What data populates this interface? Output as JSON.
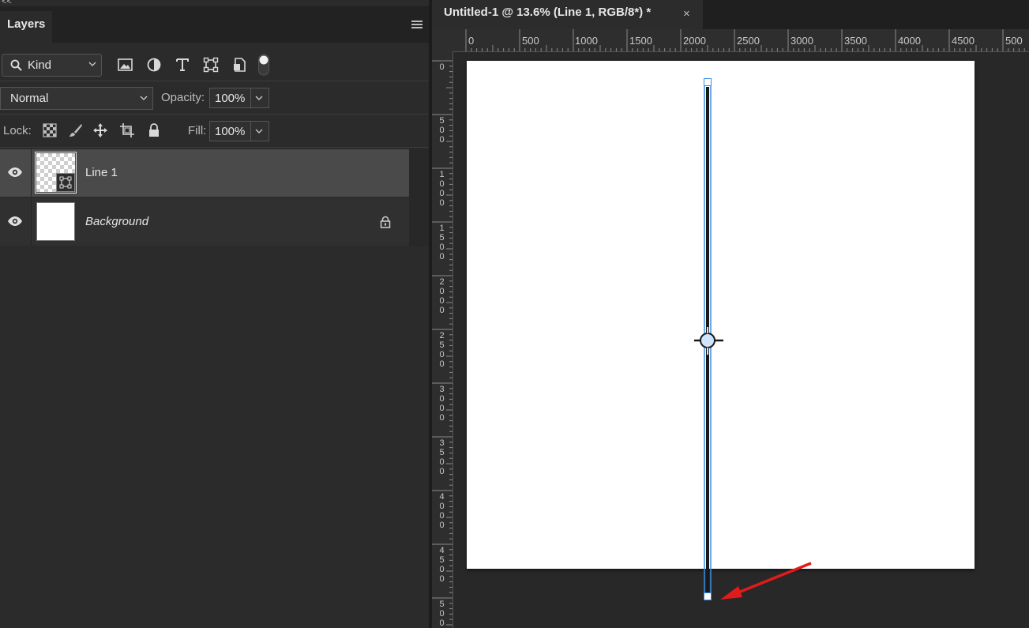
{
  "layers_panel": {
    "collapse_label": "<<",
    "tab_label": "Layers",
    "filter": {
      "kind_label": "Kind"
    },
    "blend_mode": "Normal",
    "opacity_label": "Opacity:",
    "opacity_value": "100%",
    "lock_label": "Lock:",
    "fill_label": "Fill:",
    "fill_value": "100%",
    "layers": [
      {
        "name": "Line 1",
        "selected": true,
        "type": "shape"
      },
      {
        "name": "Background",
        "selected": false,
        "type": "pixel",
        "locked": true
      }
    ]
  },
  "document": {
    "tab_title": "Untitled-1 @ 13.6% (Line 1, RGB/8*) *",
    "close_glyph": "×",
    "ruler_h_labels": [
      "0",
      "500",
      "1000",
      "1500",
      "2000",
      "2500",
      "3000",
      "3500",
      "4000",
      "4500",
      "500"
    ],
    "ruler_v_labels": [
      "0",
      "500",
      "1000",
      "1500",
      "2000",
      "2500",
      "3000",
      "3500",
      "4000",
      "4500",
      "500"
    ]
  },
  "colors": {
    "accent": "#3a8ee6",
    "line": "#1a1a1a",
    "arrow": "#e11b1b"
  }
}
